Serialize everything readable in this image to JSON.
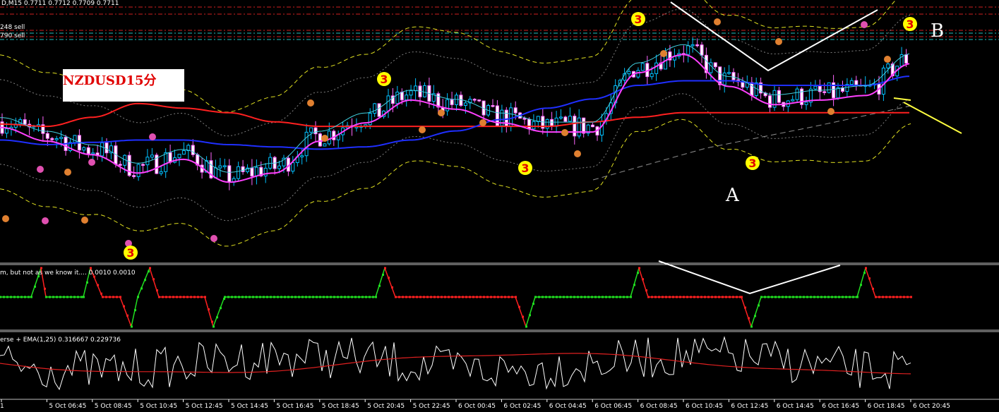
{
  "window": {
    "title": "D,M15  0.7711 0.7712 0.7709 0.7711"
  },
  "main_panel": {
    "order_line_labels": [
      "248 sell",
      "790 sell"
    ],
    "note_label": "NZDUSD15分",
    "annotation_a": "A",
    "annotation_b": "B"
  },
  "indicator1": {
    "label": "m, but not as we know it.... 0.0010 0.0010"
  },
  "indicator2": {
    "label": "erse + EMA(1,25) 0.316667 0.229736"
  },
  "x_axis": {
    "labels": [
      "1",
      "5 Oct 06:45",
      "5 Oct 08:45",
      "5 Oct 10:45",
      "5 Oct 12:45",
      "5 Oct 14:45",
      "5 Oct 16:45",
      "5 Oct 18:45",
      "5 Oct 20:45",
      "5 Oct 22:45",
      "6 Oct 00:45",
      "6 Oct 02:45",
      "6 Oct 04:45",
      "6 Oct 06:45",
      "6 Oct 08:45",
      "6 Oct 10:45",
      "6 Oct 12:45",
      "6 Oct 14:45",
      "6 Oct 16:45",
      "6 Oct 18:45",
      "6 Oct 20:45"
    ]
  },
  "colors": {
    "background": "#000000",
    "bull_candle": "#00c0ff",
    "bear_candle": "#ff66ff",
    "ma_red": "#ff2020",
    "ma_blue": "#1f2fff",
    "ma_magenta": "#ff40ff",
    "ma_cyan": "#40d0e0",
    "band_yellow": "#e0e020",
    "band_gray": "#808080",
    "step_green": "#20e020",
    "step_red": "#ff2020",
    "osc_white": "#ffffff",
    "osc_red": "#e02020",
    "badge_yellow": "#ffff00",
    "badge_orange": "#e08030",
    "badge_pink": "#e050b0"
  },
  "chart_data": [
    {
      "type": "line",
      "x": [
        "1",
        "5 Oct 06:45",
        "5 Oct 08:45",
        "5 Oct 10:45",
        "5 Oct 12:45",
        "5 Oct 14:45",
        "5 Oct 16:45",
        "5 Oct 18:45",
        "5 Oct 20:45",
        "5 Oct 22:45",
        "6 Oct 00:45",
        "6 Oct 02:45",
        "6 Oct 04:45",
        "6 Oct 06:45",
        "6 Oct 08:45",
        "6 Oct 10:45",
        "6 Oct 12:45",
        "6 Oct 14:45",
        "6 Oct 16:45",
        "6 Oct 18:45",
        "6 Oct 20:45"
      ],
      "series": [
        {
          "values": [
            58,
            52,
            46,
            38,
            44,
            34,
            38,
            52,
            60,
            70,
            66,
            60,
            56,
            56,
            82,
            90,
            76,
            68,
            70,
            72,
            86
          ]
        },
        {
          "values": [
            50,
            48,
            49,
            50,
            50,
            48,
            47,
            46,
            47,
            50,
            54,
            59,
            64,
            68,
            74,
            76,
            76,
            74,
            74,
            74,
            78
          ]
        },
        {
          "values": [
            57,
            56,
            60,
            66,
            64,
            62,
            58,
            56,
            56,
            56,
            56,
            56,
            56,
            58,
            60,
            62,
            62,
            62,
            62,
            62,
            62
          ]
        }
      ],
      "markers": [
        {
          "x": "5 Oct 10:45",
          "label": "3"
        },
        {
          "x": "5 Oct 22:45",
          "label": "3"
        },
        {
          "x": "6 Oct 04:45",
          "label": "3"
        },
        {
          "x": "6 Oct 08:45",
          "label": "3"
        },
        {
          "x": "6 Oct 14:45",
          "label": "3"
        },
        {
          "x": "6 Oct 20:45",
          "label": "3"
        }
      ]
    },
    {
      "type": "line",
      "label": "m, but not as we know it.... 0.0010 0.0010"
    },
    {
      "type": "line",
      "label": "erse + EMA(1,25) 0.316667 0.229736"
    }
  ]
}
